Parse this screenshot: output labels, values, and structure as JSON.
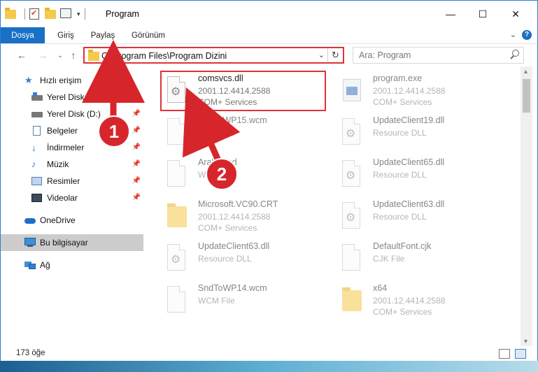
{
  "window": {
    "title": "Program",
    "controls": {
      "minimize": "—",
      "maximize": "☐",
      "close": "✕"
    }
  },
  "ribbon": {
    "tabs": [
      "Dosya",
      "Giriş",
      "Paylaş",
      "Görünüm"
    ],
    "help": "?"
  },
  "address_bar": {
    "path": "C:\\Program Files\\Program Dizini"
  },
  "search": {
    "placeholder": "Ara: Program"
  },
  "sidebar": {
    "quick_access": "Hızlı erişim",
    "items": [
      {
        "label": "Yerel Disk (C:)",
        "icon": "drive-icon"
      },
      {
        "label": "Yerel Disk (D:)",
        "icon": "drive-icon"
      },
      {
        "label": "Belgeler",
        "icon": "documents-icon"
      },
      {
        "label": "İndirmeler",
        "icon": "download-icon"
      },
      {
        "label": "Müzik",
        "icon": "music-icon"
      },
      {
        "label": "Resimler",
        "icon": "pictures-icon"
      },
      {
        "label": "Videolar",
        "icon": "videos-icon"
      }
    ],
    "onedrive": "OneDrive",
    "this_pc": "Bu bilgisayar",
    "network": "Ağ"
  },
  "files": [
    {
      "name": "comsvcs.dll",
      "line1": "2001.12.4414.2588",
      "line2": "COM+ Services",
      "type": "dll"
    },
    {
      "name": "program.exe",
      "line1": "2001.12.4414.2588",
      "line2": "COM+ Services",
      "type": "exe"
    },
    {
      "name": "SndToWP15.wcm",
      "line1": "WCM File",
      "line2": "",
      "type": "doc"
    },
    {
      "name": "UpdateClient19.dll",
      "line1": "Resource DLL",
      "line2": "",
      "type": "dll"
    },
    {
      "name": "Arabic.lnd",
      "line1": "WRD File",
      "line2": "",
      "type": "doc"
    },
    {
      "name": "UpdateClient65.dll",
      "line1": "Resource DLL",
      "line2": "",
      "type": "dll"
    },
    {
      "name": "Microsoft.VC90.CRT",
      "line1": "2001.12.4414.2588",
      "line2": "COM+ Services",
      "type": "folder"
    },
    {
      "name": "UpdateClient63.dll",
      "line1": "Resource DLL",
      "line2": "",
      "type": "dll"
    },
    {
      "name": "UpdateClient63.dll",
      "line1": "Resource DLL",
      "line2": "",
      "type": "dll"
    },
    {
      "name": "DefaultFont.cjk",
      "line1": "CJK File",
      "line2": "",
      "type": "doc"
    },
    {
      "name": "SndToWP14.wcm",
      "line1": "WCM File",
      "line2": "",
      "type": "doc"
    },
    {
      "name": "x64",
      "line1": "2001.12.4414.2588",
      "line2": "COM+ Services",
      "type": "folder"
    }
  ],
  "status": {
    "count": "173 öğe"
  },
  "annotations": {
    "step1": "1",
    "step2": "2",
    "color": "#d6262b"
  }
}
